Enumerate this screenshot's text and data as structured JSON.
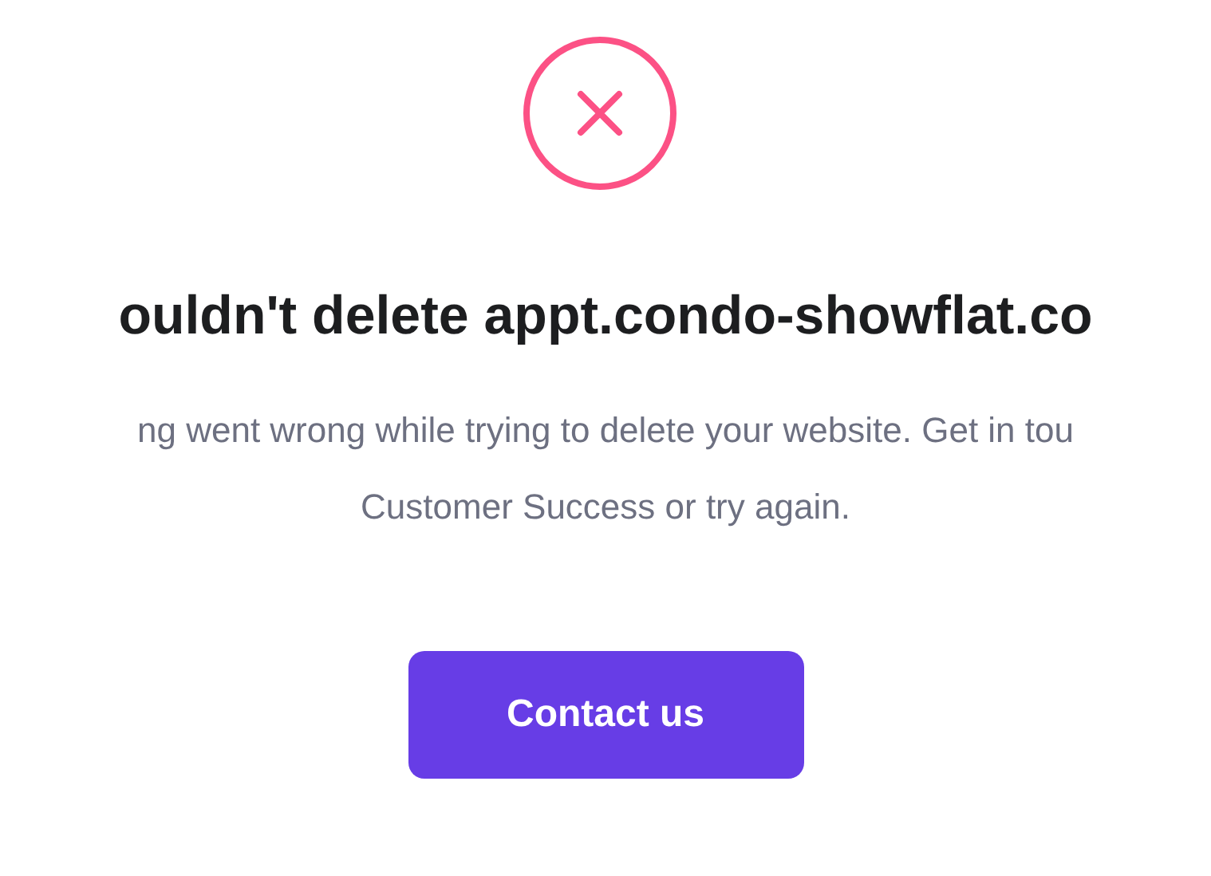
{
  "status": {
    "kind": "error"
  },
  "heading": "ouldn't delete appt.condo-showflat.co",
  "message_lines": [
    "ng went wrong while trying to delete your website. Get in tou",
    "Customer Success or try again."
  ],
  "button": "Contact us"
}
